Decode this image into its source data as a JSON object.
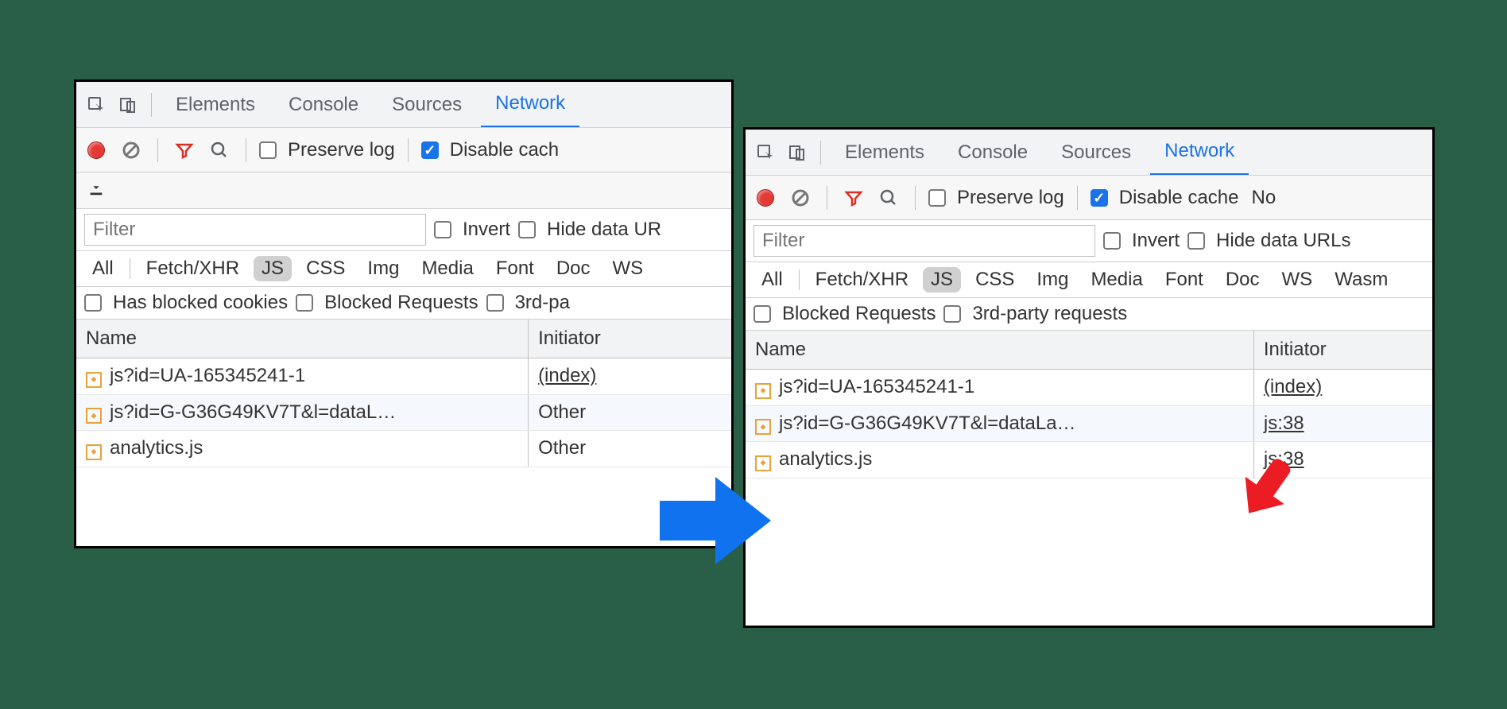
{
  "tabs": {
    "elements": "Elements",
    "console": "Console",
    "sources": "Sources",
    "network": "Network"
  },
  "toolbar": {
    "preserve_log": "Preserve log",
    "disable_cache": "Disable cach",
    "disable_cache_full": "Disable cache",
    "no_label_right": "No"
  },
  "filter": {
    "placeholder": "Filter",
    "invert": "Invert",
    "hide_data_left": "Hide data UR",
    "hide_data_right": "Hide data URLs"
  },
  "types": [
    "All",
    "Fetch/XHR",
    "JS",
    "CSS",
    "Img",
    "Media",
    "Font",
    "Doc",
    "WS",
    "Wasm"
  ],
  "checks_left": {
    "blocked_cookies": "Has blocked cookies",
    "blocked_requests": "Blocked Requests",
    "third_party": "3rd-pa"
  },
  "checks_right": {
    "blocked_requests": "Blocked Requests",
    "third_party": "3rd-party requests"
  },
  "columns": {
    "name": "Name",
    "initiator": "Initiator"
  },
  "rows_left": [
    {
      "name": "js?id=UA-165345241-1",
      "initiator": "(index)",
      "link": true
    },
    {
      "name": "js?id=G-G36G49KV7T&l=dataL…",
      "initiator": "Other",
      "link": false
    },
    {
      "name": "analytics.js",
      "initiator": "Other",
      "link": false
    }
  ],
  "rows_right": [
    {
      "name": "js?id=UA-165345241-1",
      "initiator": "(index)",
      "link": true
    },
    {
      "name": "js?id=G-G36G49KV7T&l=dataLa…",
      "initiator": "js:38",
      "link": true
    },
    {
      "name": "analytics.js",
      "initiator": "js:38",
      "link": true
    }
  ]
}
